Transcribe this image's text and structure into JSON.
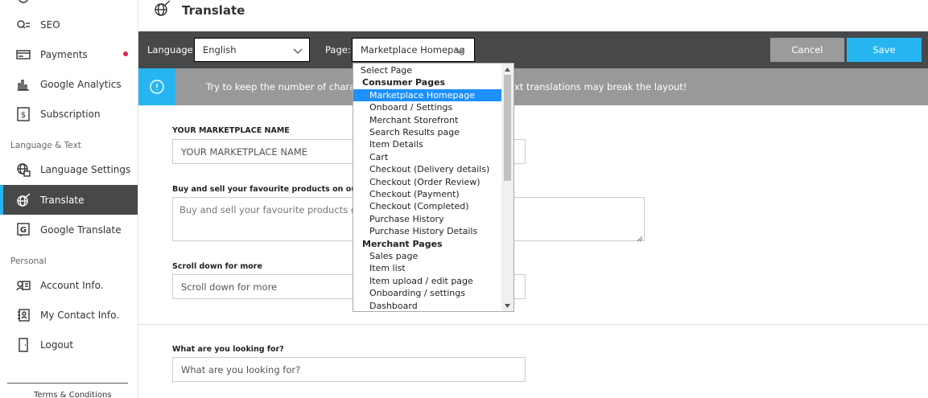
{
  "sidebar": {
    "items_top": [
      {
        "label": "SEO",
        "icon": "seo-icon"
      },
      {
        "label": "Payments",
        "icon": "payment-card-icon",
        "badge_color": "#e0204a"
      },
      {
        "label": "Google Analytics",
        "icon": "bar-chart-icon"
      },
      {
        "label": "Subscription",
        "icon": "dollar-document-icon"
      }
    ],
    "section_language": "Language & Text",
    "items_language": [
      {
        "label": "Language Settings",
        "icon": "language-globe-icon"
      },
      {
        "label": "Translate",
        "icon": "translate-globe-icon",
        "active": true
      },
      {
        "label": "Google Translate",
        "icon": "google-g-icon"
      }
    ],
    "section_personal": "Personal",
    "items_personal": [
      {
        "label": "Account Info.",
        "icon": "account-card-icon"
      },
      {
        "label": "My Contact Info.",
        "icon": "contact-book-icon"
      },
      {
        "label": "Logout",
        "icon": "logout-door-icon"
      }
    ],
    "footer_link": "Terms & Conditions"
  },
  "header": {
    "title": "Translate",
    "icon": "translate-globe-icon"
  },
  "toolbar": {
    "language_label": "Language:",
    "language_value": "English",
    "page_label": "Page:",
    "page_value": "Marketplace Homepag",
    "cancel_label": "Cancel",
    "save_label": "Save"
  },
  "info": {
    "text_start": "Try to keep the number of character",
    "text_end": "xt translations may break the layout!",
    "icon": "info-circle-icon"
  },
  "fields": [
    {
      "label": "YOUR MARKETPLACE NAME",
      "value": "YOUR MARKETPLACE NAME",
      "type": "input"
    },
    {
      "label": "Buy and sell your favourite products on our very",
      "value": "Buy and sell your favourite products on ou",
      "type": "textarea"
    },
    {
      "label": "Scroll down for more",
      "value": "Scroll down for more",
      "type": "input"
    },
    {
      "label": "What are you looking for?",
      "value": "What are you looking for?",
      "type": "input"
    }
  ],
  "page_dropdown": {
    "items": [
      {
        "label": "Select Page",
        "kind": "first"
      },
      {
        "label": "Consumer Pages",
        "kind": "group"
      },
      {
        "label": "Marketplace Homepage",
        "kind": "opt",
        "selected": true
      },
      {
        "label": "Onboard / Settings",
        "kind": "opt"
      },
      {
        "label": "Merchant Storefront",
        "kind": "opt"
      },
      {
        "label": "Search Results page",
        "kind": "opt"
      },
      {
        "label": "Item Details",
        "kind": "opt"
      },
      {
        "label": "Cart",
        "kind": "opt"
      },
      {
        "label": "Checkout (Delivery details)",
        "kind": "opt"
      },
      {
        "label": "Checkout (Order Review)",
        "kind": "opt"
      },
      {
        "label": "Checkout (Payment)",
        "kind": "opt"
      },
      {
        "label": "Checkout (Completed)",
        "kind": "opt"
      },
      {
        "label": "Purchase History",
        "kind": "opt"
      },
      {
        "label": "Purchase History Details",
        "kind": "opt"
      },
      {
        "label": "Merchant Pages",
        "kind": "group"
      },
      {
        "label": "Sales page",
        "kind": "opt"
      },
      {
        "label": "Item list",
        "kind": "opt"
      },
      {
        "label": "Item upload / edit page",
        "kind": "opt"
      },
      {
        "label": "Onboarding / settings",
        "kind": "opt"
      },
      {
        "label": "Dashboard",
        "kind": "opt"
      }
    ]
  },
  "colors": {
    "accent": "#26b5f0",
    "toolbar_bg": "#47484a",
    "info_bg": "#999999",
    "selection": "#1e90ff"
  }
}
